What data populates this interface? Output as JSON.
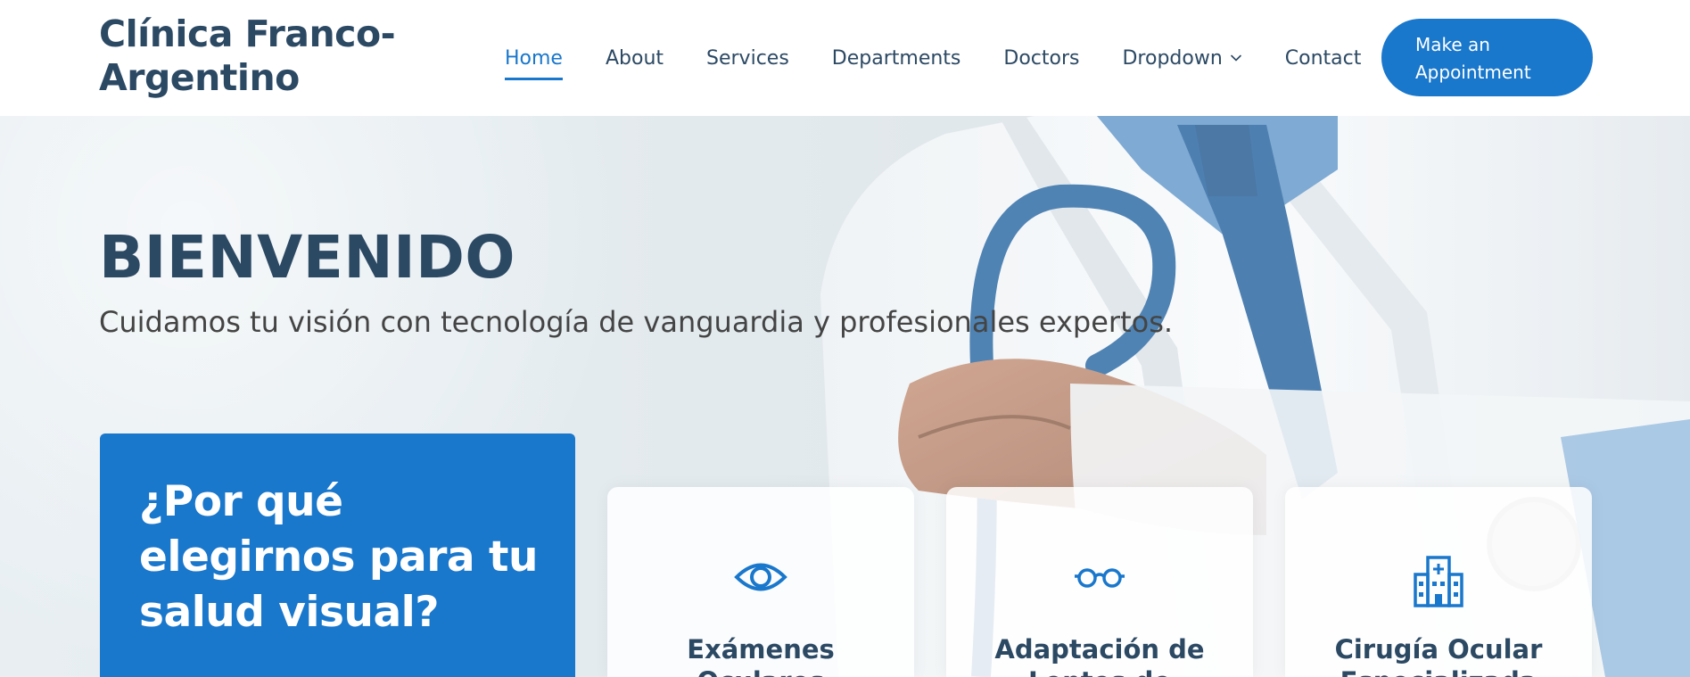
{
  "brand": {
    "name": "Clínica Franco-Argentino",
    "accent": "#1977cc",
    "heading_color": "#2c4964"
  },
  "nav": {
    "items": [
      {
        "label": "Home",
        "active": true
      },
      {
        "label": "About"
      },
      {
        "label": "Services"
      },
      {
        "label": "Departments"
      },
      {
        "label": "Doctors"
      },
      {
        "label": "Dropdown",
        "icon": "chevron-down-icon"
      },
      {
        "label": "Contact"
      }
    ],
    "cta_label": "Make an Appointment"
  },
  "hero": {
    "title": "BIENVENIDO",
    "subtitle": "Cuidamos tu visión con tecnología de vanguardia y profesionales expertos."
  },
  "why": {
    "title": "¿Por qué elegirnos para tu salud visual?"
  },
  "cards": [
    {
      "title": "Exámenes Oculares",
      "icon": "eye-icon"
    },
    {
      "title": "Adaptación de Lentes de",
      "icon": "glasses-icon"
    },
    {
      "title": "Cirugía Ocular Especializada",
      "icon": "hospital-icon"
    }
  ]
}
